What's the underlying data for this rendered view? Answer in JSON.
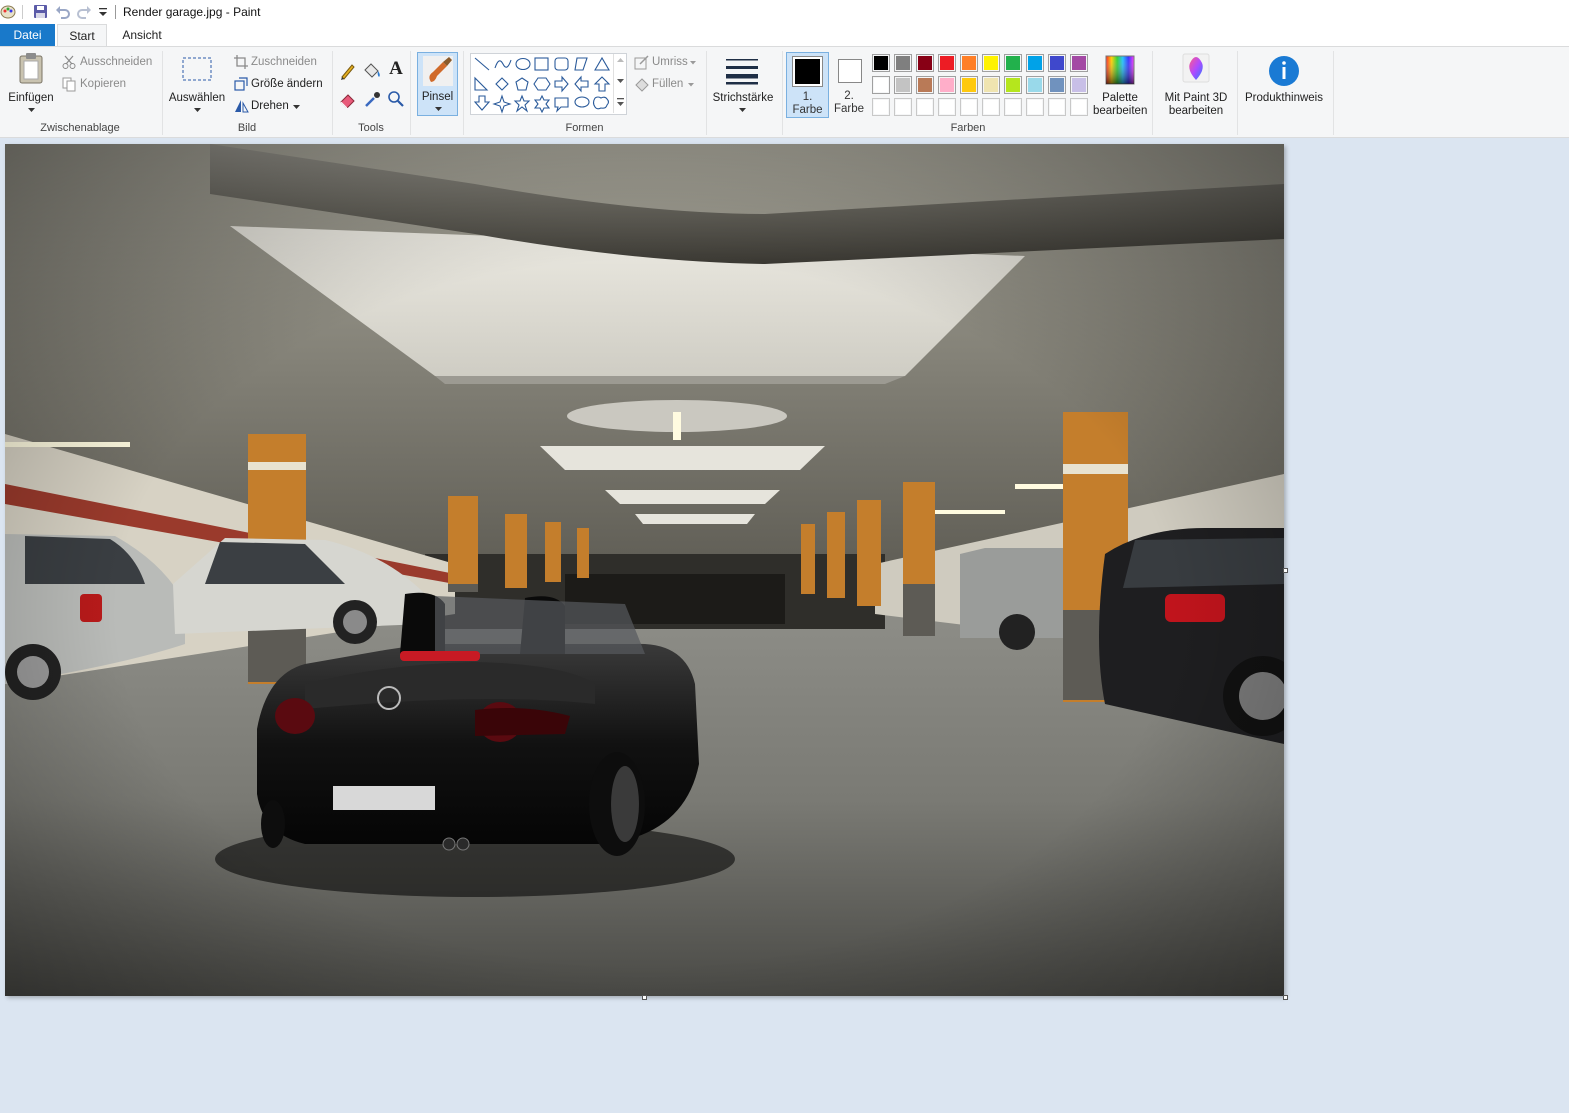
{
  "window": {
    "title": "Render garage.jpg - Paint"
  },
  "menu": {
    "file": "Datei",
    "start": "Start",
    "view": "Ansicht"
  },
  "clipboard": {
    "paste": "Einfügen",
    "cut": "Ausschneiden",
    "copy": "Kopieren",
    "group": "Zwischenablage"
  },
  "image": {
    "select": "Auswählen",
    "crop": "Zuschneiden",
    "resize": "Größe ändern",
    "rotate": "Drehen",
    "group": "Bild"
  },
  "tools": {
    "group": "Tools"
  },
  "brush": {
    "label": "Pinsel"
  },
  "shapes": {
    "outline": "Umriss",
    "fill": "Füllen",
    "group": "Formen"
  },
  "size": {
    "label": "Strichstärke"
  },
  "colors": {
    "color1_line1": "1.",
    "color1_line2": "Farbe",
    "color2_line1": "2.",
    "color2_line2": "Farbe",
    "group": "Farben",
    "edit_line1": "Palette",
    "edit_line2": "bearbeiten",
    "color1_value": "#000000",
    "color2_value": "#ffffff",
    "palette_row1": [
      "#000000",
      "#7f7f7f",
      "#880015",
      "#ed1c24",
      "#ff7f27",
      "#fff200",
      "#22b14c",
      "#00a2e8",
      "#3f48cc",
      "#a349a4"
    ],
    "palette_row2": [
      "#ffffff",
      "#c3c3c3",
      "#b97a57",
      "#ffaec9",
      "#ffc90e",
      "#efe4b0",
      "#b5e61d",
      "#99d9ea",
      "#7092be",
      "#c8bfe7"
    ],
    "palette_row3": [
      "#ffffff",
      "#ffffff",
      "#ffffff",
      "#ffffff",
      "#ffffff",
      "#ffffff",
      "#ffffff",
      "#ffffff",
      "#ffffff",
      "#ffffff"
    ]
  },
  "paint3d": {
    "line1": "Mit Paint 3D",
    "line2": "bearbeiten"
  },
  "product": {
    "label": "Produkthinweis"
  },
  "accent": "#1979ca"
}
